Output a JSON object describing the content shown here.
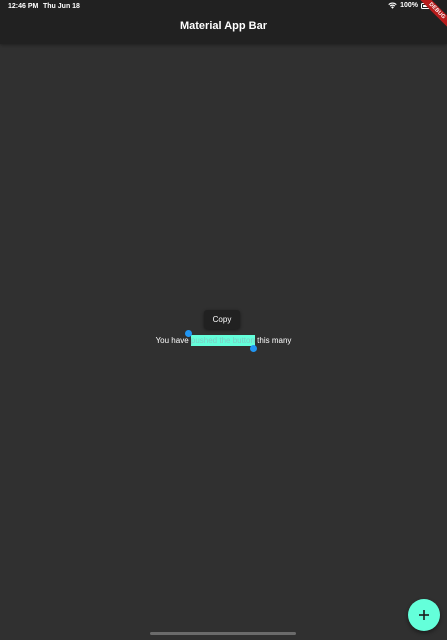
{
  "status_bar": {
    "time": "12:46 PM",
    "date": "Thu Jun 18",
    "battery": "100%"
  },
  "app_bar": {
    "title": "Material App Bar"
  },
  "debug_banner": {
    "label": "DEBUG"
  },
  "selection_toolbar": {
    "copy_label": "Copy"
  },
  "body": {
    "text_before": "You have ",
    "text_selected": "pushed the button",
    "text_after": " this many"
  },
  "colors": {
    "background": "#303030",
    "app_bar": "#212121",
    "accent": "#64ffda",
    "selection_handle": "#2196f3"
  },
  "icons": {
    "fab": "plus-icon",
    "wifi": "wifi-icon",
    "battery": "battery-icon"
  }
}
